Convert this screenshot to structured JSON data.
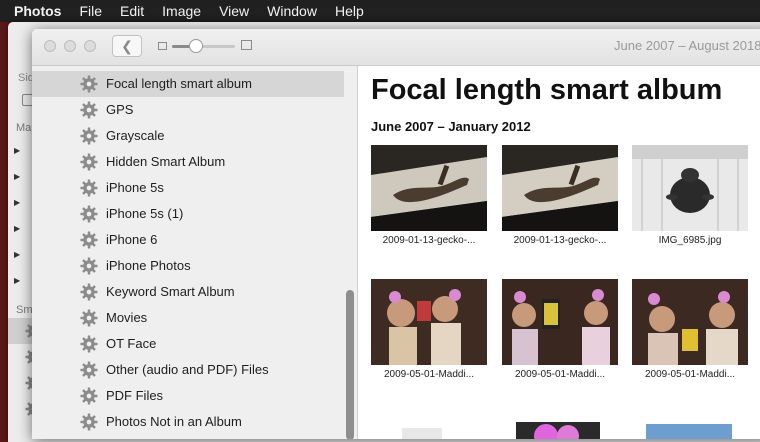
{
  "menu": [
    "Photos",
    "File",
    "Edit",
    "Image",
    "View",
    "Window",
    "Help"
  ],
  "background_window": {
    "sidebar_label": "Sid",
    "section_1": "Ma",
    "section_2": "Sm"
  },
  "window": {
    "title": "June 2007 – August 2018",
    "back_icon": "chevron-left-icon",
    "zoom_slider": {
      "value_fraction": 0.36
    }
  },
  "sidebar": {
    "items": [
      {
        "label": "Focal length smart album",
        "selected": true
      },
      {
        "label": "GPS"
      },
      {
        "label": "Grayscale"
      },
      {
        "label": "Hidden Smart Album"
      },
      {
        "label": "iPhone 5s"
      },
      {
        "label": "iPhone 5s (1)"
      },
      {
        "label": "iPhone 6"
      },
      {
        "label": "iPhone Photos"
      },
      {
        "label": "Keyword Smart Album"
      },
      {
        "label": "Movies"
      },
      {
        "label": "OT Face"
      },
      {
        "label": "Other (audio and PDF) Files"
      },
      {
        "label": "PDF Files"
      },
      {
        "label": "Photos Not in an Album"
      }
    ],
    "item_icon": "gear-icon"
  },
  "content": {
    "album_title": "Focal length smart album",
    "date_range": "June 2007 – January 2012",
    "photos": [
      {
        "caption": "2009-01-13-gecko-..."
      },
      {
        "caption": "2009-01-13-gecko-..."
      },
      {
        "caption": "IMG_6985.jpg"
      },
      {
        "caption": "2009-05-01-Maddi..."
      },
      {
        "caption": "2009-05-01-Maddi..."
      },
      {
        "caption": "2009-05-01-Maddi..."
      }
    ]
  },
  "colors": {
    "desktop": "#5a1818",
    "menubar": "#202020",
    "sidebar": "#efefef",
    "selection": "#d6d6d6"
  }
}
